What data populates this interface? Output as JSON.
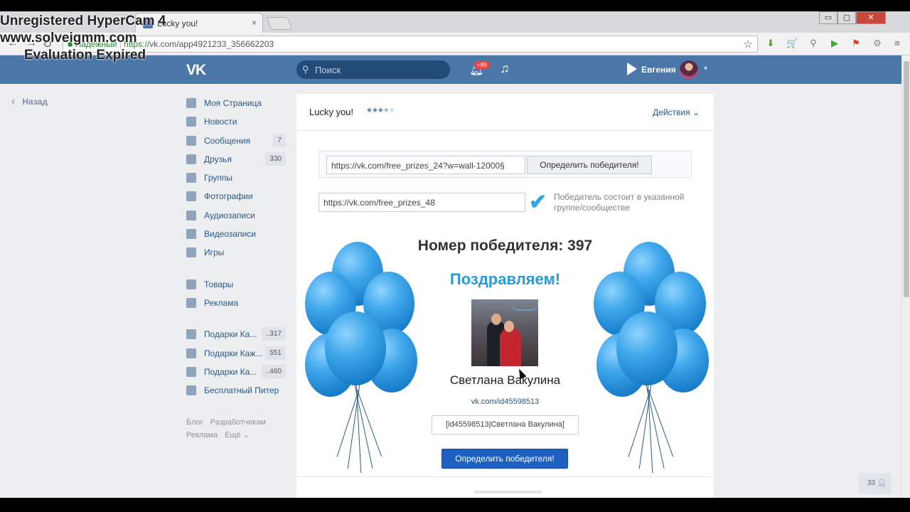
{
  "watermark": {
    "line1": "Unregistered HyperCam 4",
    "line2": "www.solveigmm.com",
    "line3": "Evaluation Expired"
  },
  "browser": {
    "tab_title": "Lucky you!",
    "tab_close": "×",
    "url_secure": "Надежный",
    "url_scheme": "https://",
    "url_rest": "vk.com/app4921233_356662203",
    "star": "☆",
    "window_controls": [
      "▭",
      "▢",
      "✕"
    ]
  },
  "vk_header": {
    "logo": "VK",
    "search_placeholder": "Поиск",
    "notifications_badge": "+99",
    "user_name": "Евгения"
  },
  "back_link": "Назад",
  "left_nav": {
    "items": [
      {
        "label": "Моя Страница",
        "icon": "home-icon",
        "count": ""
      },
      {
        "label": "Новости",
        "icon": "news-icon",
        "count": ""
      },
      {
        "label": "Сообщения",
        "icon": "messages-icon",
        "count": "7"
      },
      {
        "label": "Друзья",
        "icon": "friends-icon",
        "count": "330"
      },
      {
        "label": "Группы",
        "icon": "groups-icon",
        "count": ""
      },
      {
        "label": "Фотографии",
        "icon": "camera-icon",
        "count": ""
      },
      {
        "label": "Аудиозаписи",
        "icon": "music-icon",
        "count": ""
      },
      {
        "label": "Видеозаписи",
        "icon": "video-icon",
        "count": ""
      },
      {
        "label": "Игры",
        "icon": "gamepad-icon",
        "count": ""
      }
    ],
    "items2": [
      {
        "label": "Товары",
        "icon": "bag-icon",
        "count": ""
      },
      {
        "label": "Реклама",
        "icon": "megaphone-icon",
        "count": ""
      }
    ],
    "items3": [
      {
        "label": "Подарки Ка...",
        "icon": "group-icon",
        "count": "..317"
      },
      {
        "label": "Подарки Каж...",
        "icon": "group-icon",
        "count": "551"
      },
      {
        "label": "Подарки Ка...",
        "icon": "group-icon",
        "count": "..460"
      },
      {
        "label": "Бесплатный Питер",
        "icon": "group-icon",
        "count": ""
      }
    ],
    "footer": [
      "Блог",
      "Разработчикам",
      "Реклама",
      "Ещё ⌄"
    ]
  },
  "app": {
    "title": "Lucky you!",
    "rating_stars": 3.5,
    "actions_label": "Действия ⌄",
    "post_url": "https://vk.com/free_prizes_24?w=wall-12000§",
    "determine_button": "Определить победителя!",
    "group_url": "https://vk.com/free_prizes_48",
    "check_label": "Победитель состоит в указанной группе/сообществе",
    "winner_number_text": "Номер победителя: 397",
    "congrats": "Поздравляем!",
    "winner_name": "Светлана Вакулина",
    "winner_link": "vk.com/id45598513",
    "winner_tag": "[id45598513|Светлана Вакулина]",
    "determine_button_blue": "Определить победителя!"
  },
  "chat_widget": "33"
}
